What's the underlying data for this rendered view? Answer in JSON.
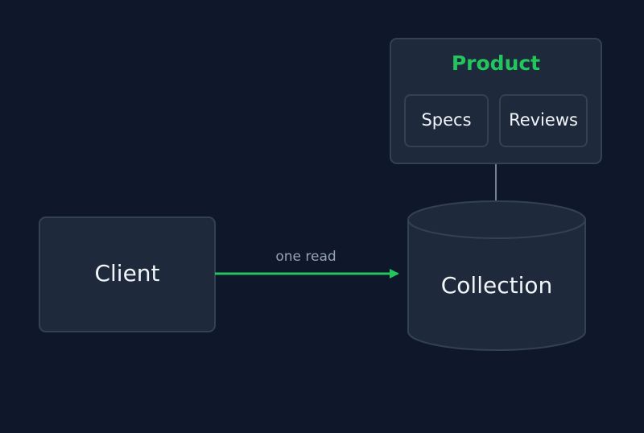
{
  "diagram": {
    "client": {
      "label": "Client"
    },
    "edge": {
      "label": "one read"
    },
    "collection": {
      "label": "Collection"
    },
    "document": {
      "title": "Product",
      "fields": [
        {
          "label": "Specs"
        },
        {
          "label": "Reviews"
        }
      ]
    }
  },
  "colors": {
    "background": "#0f172a",
    "node_fill": "#1e293b",
    "node_stroke": "#334155",
    "accent_green": "#22c55e",
    "edge_label": "#94a3b8",
    "connector": "#94a3b8",
    "text": "#f1f5f9"
  }
}
